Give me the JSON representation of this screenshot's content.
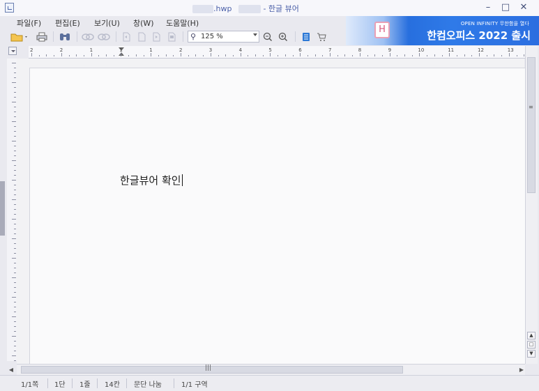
{
  "window": {
    "title_file_ext": ".hwp",
    "title_app": "- 한글 뷰어",
    "minimize": "–",
    "maximize": "□",
    "close": "✕"
  },
  "menu": [
    {
      "label": "파일(F)"
    },
    {
      "label": "편집(E)"
    },
    {
      "label": "보기(U)"
    },
    {
      "label": "창(W)"
    },
    {
      "label": "도움말(H)"
    }
  ],
  "toolbar": {
    "zoom_value": "125 %",
    "icons": [
      "open-folder-icon",
      "print-icon",
      "find-binoculars-icon",
      "link-icon",
      "unlink-icon",
      "page-prev-icon",
      "page-icon",
      "page-next-icon",
      "page-last-icon",
      "zoom-out-icon",
      "zoom-in-icon",
      "bookmark-icon",
      "cart-icon"
    ]
  },
  "banner": {
    "tagline": "OPEN INFINITY 무한함을 열다",
    "headline": "한컴오피스 2022 출시",
    "logo_letter": "H"
  },
  "ruler": {
    "labels": [
      "2",
      "2",
      "1",
      "1",
      "1",
      "2",
      "3",
      "4",
      "5",
      "6",
      "7",
      "8",
      "9",
      "10",
      "11",
      "12",
      "13"
    ]
  },
  "document": {
    "text": "한글뷰어 확인"
  },
  "status": {
    "page": "1/1쪽",
    "column": "1단",
    "line": "1줄",
    "char": "14칸",
    "break": "문단 나눔",
    "section": "1/1 구역"
  },
  "colors": {
    "banner_blue": "#2f7ae8",
    "title_text": "#4a5fa8",
    "page_bg": "#fafafb"
  }
}
